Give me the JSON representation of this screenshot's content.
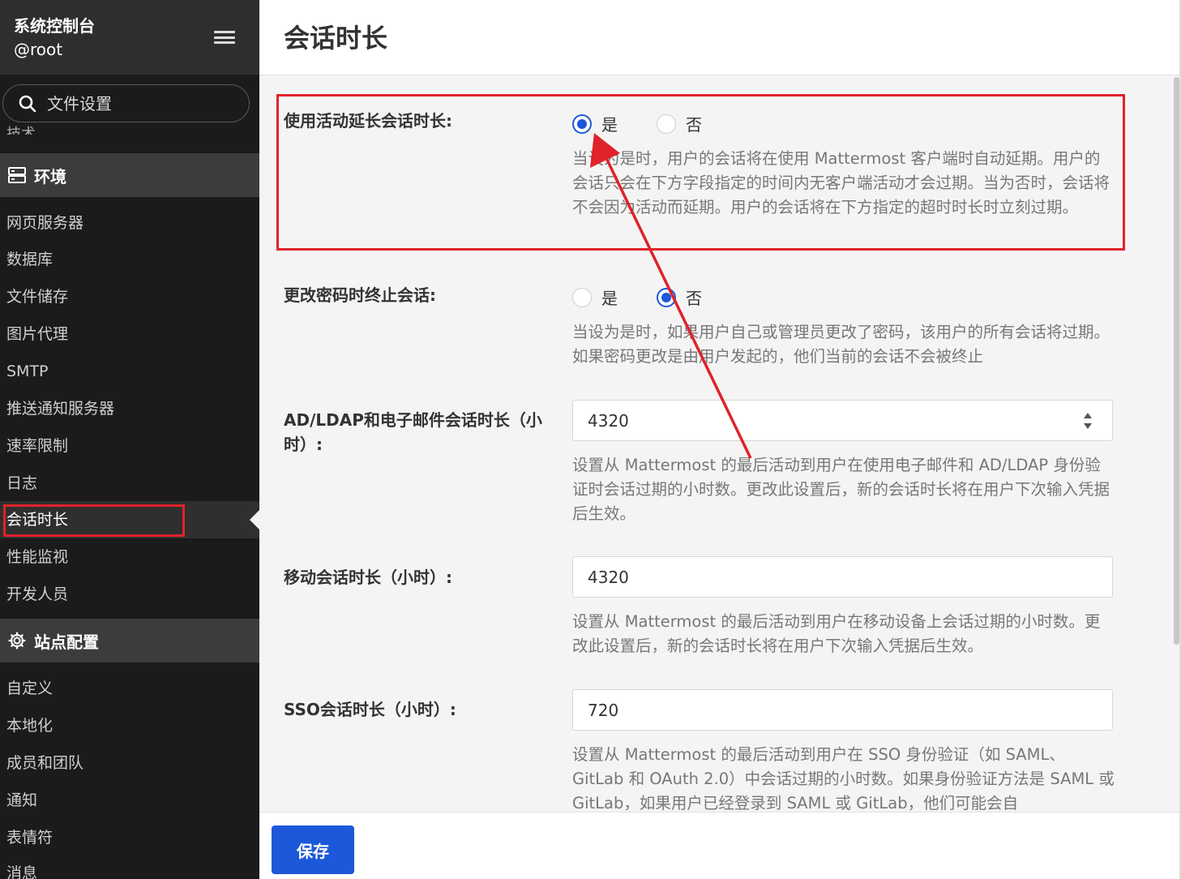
{
  "sidebar": {
    "title": "系统控制台",
    "user": "@root",
    "search_placeholder": "文件设置",
    "cut_item": "技术",
    "env_section": "环境",
    "env_items": [
      "网页服务器",
      "数据库",
      "文件储存",
      "图片代理",
      "SMTP",
      "推送通知服务器",
      "速率限制",
      "日志",
      "会话时长",
      "性能监视",
      "开发人员"
    ],
    "site_section": "站点配置",
    "site_items": [
      "自定义",
      "本地化",
      "成员和团队",
      "通知",
      "表情符",
      "消息"
    ],
    "active_item": "会话时长"
  },
  "page": {
    "title": "会话时长"
  },
  "settings": {
    "extend_label": "使用活动延长会话时长:",
    "extend_yes": "是",
    "extend_no": "否",
    "extend_value": "是",
    "extend_help": "当设为是时，用户的会话将在使用 Mattermost 客户端时自动延期。用户的会话只会在下方字段指定的时间内无客户端活动才会过期。当为否时，会话将不会因为活动而延期。用户的会话将在下方指定的超时时长时立刻过期。",
    "terminate_label": "更改密码时终止会话:",
    "terminate_yes": "是",
    "terminate_no": "否",
    "terminate_value": "否",
    "terminate_help": "当设为是时，如果用户自己或管理员更改了密码，该用户的所有会话将过期。如果密码更改是由用户发起的，他们当前的会话不会被终止",
    "ldap_label": "AD/LDAP和电子邮件会话时长（小时）:",
    "ldap_value": "4320",
    "ldap_help": "设置从 Mattermost 的最后活动到用户在使用电子邮件和 AD/LDAP 身份验证时会话过期的小时数。更改此设置后，新的会话时长将在用户下次输入凭据后生效。",
    "mobile_label": "移动会话时长（小时）:",
    "mobile_value": "4320",
    "mobile_help": "设置从 Mattermost 的最后活动到用户在移动设备上会话过期的小时数。更改此设置后，新的会话时长将在用户下次输入凭据后生效。",
    "sso_label": "SSO会话时长（小时）:",
    "sso_value": "720",
    "sso_help": "设置从 Mattermost 的最后活动到用户在 SSO 身份验证（如 SAML、GitLab 和 OAuth 2.0）中会话过期的小时数。如果身份验证方法是 SAML 或 GitLab，如果用户已经登录到 SAML 或 GitLab，他们可能会自"
  },
  "footer": {
    "save_label": "保存"
  },
  "colors": {
    "accent": "#1c58d9",
    "annotation": "#e0222b",
    "sidebar_bg": "#1b1b1b"
  }
}
